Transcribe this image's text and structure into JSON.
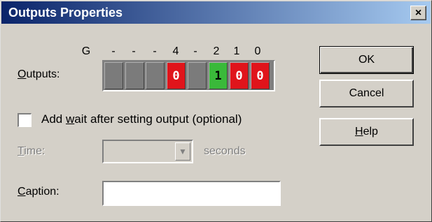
{
  "window": {
    "title": "Outputs Properties",
    "close_glyph": "×"
  },
  "bits": {
    "headers": [
      "G",
      "-",
      "-",
      "-",
      "4",
      "-",
      "2",
      "1",
      "0"
    ],
    "values": [
      "",
      "",
      "",
      "0",
      "",
      "1",
      "0",
      "0"
    ],
    "states": [
      "off",
      "off",
      "off",
      "zero",
      "off",
      "one",
      "zero",
      "zero"
    ],
    "colors": {
      "zero": "#e0141b",
      "one": "#3ab93a",
      "off": "#7b7b7b"
    }
  },
  "outputs_label": {
    "mnemonic": "O",
    "rest": "utputs:"
  },
  "buttons": {
    "ok": "OK",
    "cancel": "Cancel",
    "help": {
      "mnemonic": "H",
      "rest": "elp"
    }
  },
  "wait_checkbox": {
    "checked": false,
    "label_pre": "Add ",
    "label_mnemonic": "w",
    "label_post": "ait after setting output (optional)"
  },
  "time": {
    "label": {
      "mnemonic": "T",
      "rest": "ime:"
    },
    "value": "",
    "units": "seconds",
    "enabled": false
  },
  "caption": {
    "label": {
      "mnemonic": "C",
      "rest": "aption:"
    },
    "value": ""
  }
}
